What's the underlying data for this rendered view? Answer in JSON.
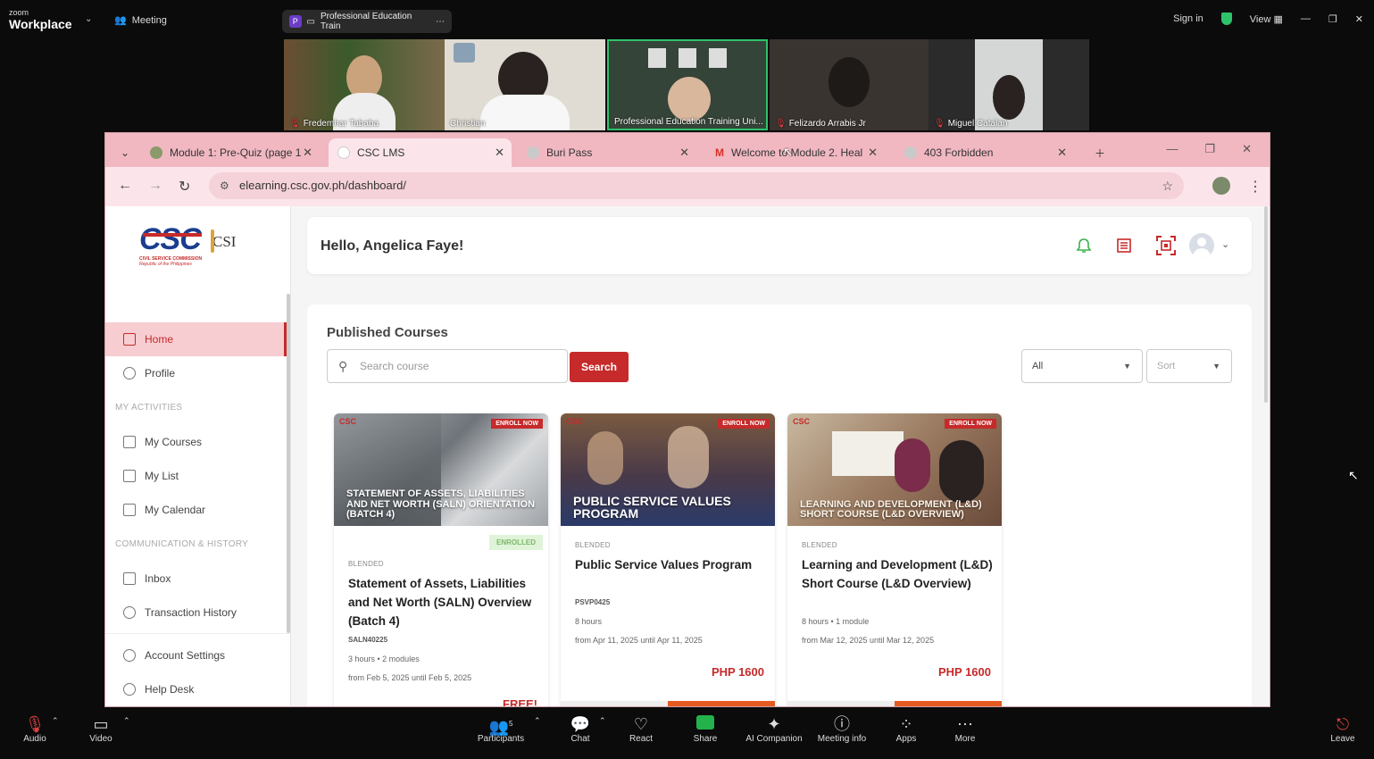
{
  "zoom": {
    "logo_small": "zoom",
    "logo_big": "Workplace",
    "meeting_label": "Meeting",
    "pill_letter": "P",
    "pill_label": "Professional Education Train",
    "sign_in": "Sign in",
    "view": "View",
    "participants_count": "5",
    "bottom": {
      "audio": "Audio",
      "video": "Video",
      "participants": "Participants",
      "chat": "Chat",
      "react": "React",
      "share": "Share",
      "ai": "AI Companion",
      "info": "Meeting info",
      "apps": "Apps",
      "more": "More",
      "leave": "Leave"
    }
  },
  "videos": [
    {
      "name": "Fredemhar Tababa",
      "color": "#5a4a3a"
    },
    {
      "name": "Christian",
      "color": "#d9d4c8"
    },
    {
      "name": "Professional Education Training Uni...",
      "color": "#3a4a3e"
    },
    {
      "name": "Felizardo Arrabis Jr",
      "color": "#2e2a28"
    },
    {
      "name": "Miguel Catalan",
      "color": "#4a4a4a"
    }
  ],
  "browser": {
    "tabs": [
      {
        "label": "Module 1: Pre-Quiz (page 1"
      },
      {
        "label": "CSC LMS"
      },
      {
        "label": "Buri Pass"
      },
      {
        "label": "Welcome to Module 2. Heal"
      },
      {
        "label": "403 Forbidden"
      }
    ],
    "url": "elearning.csc.gov.ph/dashboard/"
  },
  "sidebar": {
    "logo_text": "CSC",
    "logo_sub": "CIVIL SERVICE COMMISSION",
    "logo_sub2": "Republic of the Philippines",
    "logo_csi": "CSI",
    "items": [
      {
        "label": "Home"
      },
      {
        "label": "Profile"
      },
      {
        "label": "My Courses"
      },
      {
        "label": "My List"
      },
      {
        "label": "My Calendar"
      },
      {
        "label": "Inbox"
      },
      {
        "label": "Transaction History"
      },
      {
        "label": "Account Settings"
      },
      {
        "label": "Help Desk"
      }
    ],
    "sections": [
      "MY ACTIVITIES",
      "COMMUNICATION & HISTORY"
    ]
  },
  "header": {
    "greeting": "Hello, Angelica Faye!"
  },
  "main": {
    "title": "Published Courses",
    "search_placeholder": "Search course",
    "search_button": "Search",
    "filter_value": "All",
    "sort_value": "Sort"
  },
  "courses": [
    {
      "image_text": "STATEMENT OF ASSETS, LIABILITIES AND NET WORTH (SALN) ORIENTATION (BATCH 4)",
      "badge": "ENROLL NOW",
      "status": "ENROLLED",
      "type": "BLENDED",
      "title": "Statement of Assets, Liabilities and Net Worth (SALN) Overview (Batch 4)",
      "code": "SALN40225",
      "duration": "3 hours • 2 modules",
      "dates": "from Feb 5, 2025 until Feb 5, 2025",
      "price": "FREE!"
    },
    {
      "image_text": "PUBLIC SERVICE VALUES PROGRAM",
      "badge": "ENROLL NOW",
      "type": "BLENDED",
      "title": "Public Service Values Program",
      "code": "PSVP0425",
      "duration": "8 hours",
      "dates": "from Apr 11, 2025 until Apr 11, 2025",
      "price": "PHP 1600"
    },
    {
      "image_text": "LEARNING AND DEVELOPMENT (L&D) SHORT COURSE (L&D OVERVIEW)",
      "badge": "ENROLL NOW",
      "type": "BLENDED",
      "title": "Learning and Development (L&D) Short Course (L&D Overview)",
      "code": "",
      "duration": "8 hours • 1 module",
      "dates": "from Mar 12, 2025 until Mar 12, 2025",
      "price": "PHP 1600"
    }
  ],
  "colors": {
    "accent": "#c62a2a",
    "tabbar": "#f1b8c2",
    "zoom_bg": "#0b0b0b"
  }
}
